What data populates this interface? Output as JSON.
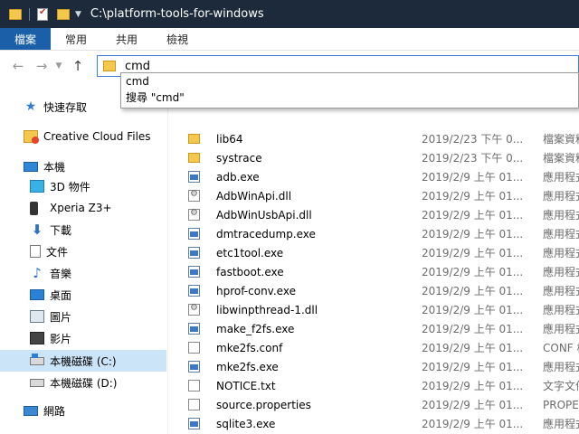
{
  "window": {
    "title": "C:\\platform-tools-for-windows"
  },
  "ribbon": {
    "tabs": [
      "檔案",
      "常用",
      "共用",
      "檢視"
    ]
  },
  "address": {
    "value": "cmd"
  },
  "autocomplete": {
    "items": [
      "cmd",
      "搜尋 \"cmd\""
    ]
  },
  "sidebar": {
    "items": [
      {
        "label": "快速存取",
        "icon": "star-icon"
      },
      {
        "label": "Creative Cloud Files",
        "icon": "creative-cloud-folder-icon"
      },
      {
        "label": "本機",
        "icon": "computer-icon"
      },
      {
        "label": "3D 物件",
        "icon": "3d-objects-icon"
      },
      {
        "label": "Xperia Z3+",
        "icon": "phone-icon"
      },
      {
        "label": "下載",
        "icon": "download-icon"
      },
      {
        "label": "文件",
        "icon": "document-icon"
      },
      {
        "label": "音樂",
        "icon": "music-icon"
      },
      {
        "label": "桌面",
        "icon": "desktop-icon"
      },
      {
        "label": "圖片",
        "icon": "pictures-icon"
      },
      {
        "label": "影片",
        "icon": "videos-icon"
      },
      {
        "label": "本機磁碟 (C:)",
        "icon": "drive-c-icon"
      },
      {
        "label": "本機磁碟 (D:)",
        "icon": "drive-d-icon"
      },
      {
        "label": "網路",
        "icon": "network-icon"
      }
    ]
  },
  "files": [
    {
      "name": "lib64",
      "date": "2019/2/23 下午 0...",
      "type": "檔案資料夾",
      "icon": "folder-icon"
    },
    {
      "name": "systrace",
      "date": "2019/2/23 下午 0...",
      "type": "檔案資料夾",
      "icon": "folder-icon"
    },
    {
      "name": "adb.exe",
      "date": "2019/2/9 上午 01...",
      "type": "應用程式",
      "icon": "exe-icon"
    },
    {
      "name": "AdbWinApi.dll",
      "date": "2019/2/9 上午 01...",
      "type": "應用程式擴",
      "icon": "dll-icon"
    },
    {
      "name": "AdbWinUsbApi.dll",
      "date": "2019/2/9 上午 01...",
      "type": "應用程式擴",
      "icon": "dll-icon"
    },
    {
      "name": "dmtracedump.exe",
      "date": "2019/2/9 上午 01...",
      "type": "應用程式",
      "icon": "exe-icon"
    },
    {
      "name": "etc1tool.exe",
      "date": "2019/2/9 上午 01...",
      "type": "應用程式",
      "icon": "exe-icon"
    },
    {
      "name": "fastboot.exe",
      "date": "2019/2/9 上午 01...",
      "type": "應用程式",
      "icon": "exe-icon"
    },
    {
      "name": "hprof-conv.exe",
      "date": "2019/2/9 上午 01...",
      "type": "應用程式",
      "icon": "exe-icon"
    },
    {
      "name": "libwinpthread-1.dll",
      "date": "2019/2/9 上午 01...",
      "type": "應用程式擴",
      "icon": "dll-icon"
    },
    {
      "name": "make_f2fs.exe",
      "date": "2019/2/9 上午 01...",
      "type": "應用程式",
      "icon": "exe-icon"
    },
    {
      "name": "mke2fs.conf",
      "date": "2019/2/9 上午 01...",
      "type": "CONF 檔案",
      "icon": "text-file-icon"
    },
    {
      "name": "mke2fs.exe",
      "date": "2019/2/9 上午 01...",
      "type": "應用程式",
      "icon": "exe-icon"
    },
    {
      "name": "NOTICE.txt",
      "date": "2019/2/9 上午 01...",
      "type": "文字文件",
      "icon": "text-file-icon"
    },
    {
      "name": "source.properties",
      "date": "2019/2/9 上午 01...",
      "type": "PROPERT",
      "icon": "text-file-icon"
    },
    {
      "name": "sqlite3.exe",
      "date": "2019/2/9 上午 01...",
      "type": "應用程式",
      "icon": "exe-icon"
    }
  ]
}
